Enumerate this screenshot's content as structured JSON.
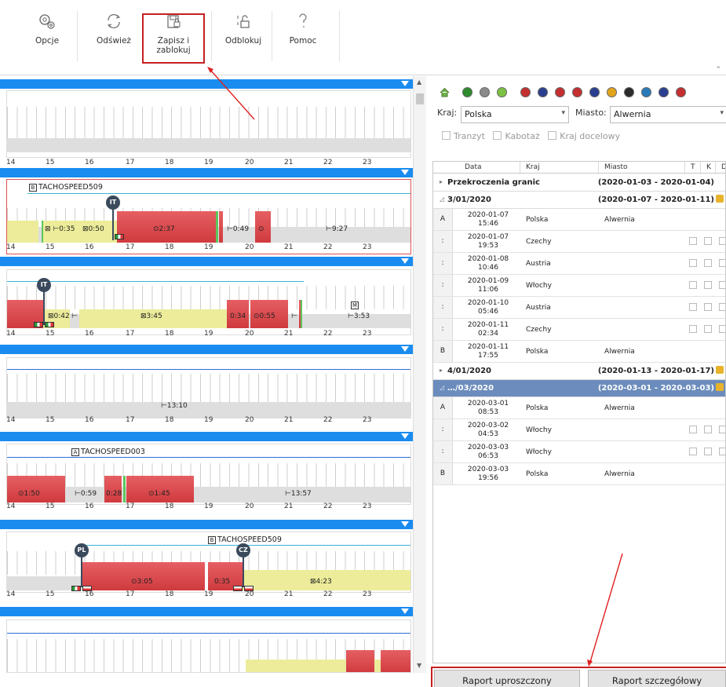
{
  "toolbar": {
    "options_label": "Opcje",
    "refresh_label": "Odśwież",
    "save_lock_label_1": "Zapisz i",
    "save_lock_label_2": "zablokuj",
    "unlock_label": "Odblokuj",
    "help_label": "Pomoc"
  },
  "axis_ticks": [
    "14",
    "15",
    "16",
    "17",
    "18",
    "19",
    "20",
    "21",
    "22",
    "23"
  ],
  "lanes": [
    {
      "labels": []
    },
    {
      "tacho_badge": "B",
      "tacho": "TACHOSPEED509",
      "pin": "IT",
      "labels": [
        "⊠ ⊢0:35",
        "⊠0:50",
        "⊙2:37",
        "⊢0:49",
        "⊙",
        "⊢9:27"
      ]
    },
    {
      "pin": "IT",
      "m_badge": "M",
      "labels": [
        "⊠0:42",
        "⊢",
        "⊠3:45",
        "0:34",
        "⊙0:55",
        "⊢",
        "⊢3:53"
      ]
    },
    {
      "labels": [
        "⊢13:10"
      ]
    },
    {
      "tacho_badge": "A",
      "tacho": "TACHOSPEED003",
      "labels": [
        "⊙1:50",
        "⊢0:59",
        "0:28",
        "⊙1:45",
        "⊢13:57"
      ]
    },
    {
      "tacho_badge": "B",
      "tacho": "TACHOSPEED509",
      "pin_a": "PL",
      "pin_b": "CZ",
      "labels": [
        "⊙3:05",
        "0:35",
        "⊠4:23"
      ]
    },
    {
      "labels": []
    }
  ],
  "filters": {
    "country_label": "Kraj:",
    "country_value": "Polska",
    "city_label": "Miasto:",
    "city_value": "Alwernia",
    "transit_label": "Tranzyt",
    "cabotage_label": "Kabotaż",
    "destination_label": "Kraj docelowy"
  },
  "flag_colors": [
    "#2e8b2e",
    "#8a8a8a",
    "#7cc242",
    "#c43030",
    "#2a3f8f",
    "#c43030",
    "#c43030",
    "#2a3f8f",
    "#e2a41c",
    "#2b2b2b",
    "#2a7ab8",
    "#2a3f8f",
    "#c43030"
  ],
  "grid": {
    "headers": {
      "data": "Data",
      "kraj": "Kraj",
      "miasto": "Miasto",
      "t": "T",
      "k": "K",
      "d": "D"
    },
    "groups": [
      {
        "name": "Przekroczenia granic",
        "range": "(2020-01-03 - 2020-01-04)",
        "arrow": "▸"
      },
      {
        "name": "3/01/2020",
        "range": "(2020-01-07 - 2020-01-11)",
        "arrow": "◿"
      },
      {
        "name": "4/01/2020",
        "range": "(2020-01-13 - 2020-01-17)",
        "arrow": "▸"
      },
      {
        "name": "…/03/2020",
        "range": "(2020-03-01 - 2020-03-03)",
        "arrow": "◿"
      }
    ],
    "rows_group1": [
      {
        "id": "A",
        "date": "2020-01-07",
        "time": "15:46",
        "kraj": "Polska",
        "miasto": "Alwernia"
      },
      {
        "id": ":",
        "date": "2020-01-07",
        "time": "19:53",
        "kraj": "Czechy",
        "miasto": ""
      },
      {
        "id": ":",
        "date": "2020-01-08",
        "time": "10:46",
        "kraj": "Austria",
        "miasto": ""
      },
      {
        "id": ":",
        "date": "2020-01-09",
        "time": "11:06",
        "kraj": "Włochy",
        "miasto": ""
      },
      {
        "id": ":",
        "date": "2020-01-10",
        "time": "05:46",
        "kraj": "Austria",
        "miasto": ""
      },
      {
        "id": ":",
        "date": "2020-01-11",
        "time": "02:34",
        "kraj": "Czechy",
        "miasto": ""
      },
      {
        "id": "B",
        "date": "2020-01-11",
        "time": "17:55",
        "kraj": "Polska",
        "miasto": "Alwernia"
      }
    ],
    "rows_group3": [
      {
        "id": "A",
        "date": "2020-03-01",
        "time": "08:53",
        "kraj": "Polska",
        "miasto": "Alwernia"
      },
      {
        "id": ":",
        "date": "2020-03-02",
        "time": "04:53",
        "kraj": "Włochy",
        "miasto": ""
      },
      {
        "id": ":",
        "date": "2020-03-03",
        "time": "06:53",
        "kraj": "Włochy",
        "miasto": ""
      },
      {
        "id": "B",
        "date": "2020-03-03",
        "time": "19:56",
        "kraj": "Polska",
        "miasto": "Alwernia"
      }
    ]
  },
  "buttons": {
    "simple_report": "Raport uproszczony",
    "detailed_report": "Raport szczegółowy"
  }
}
